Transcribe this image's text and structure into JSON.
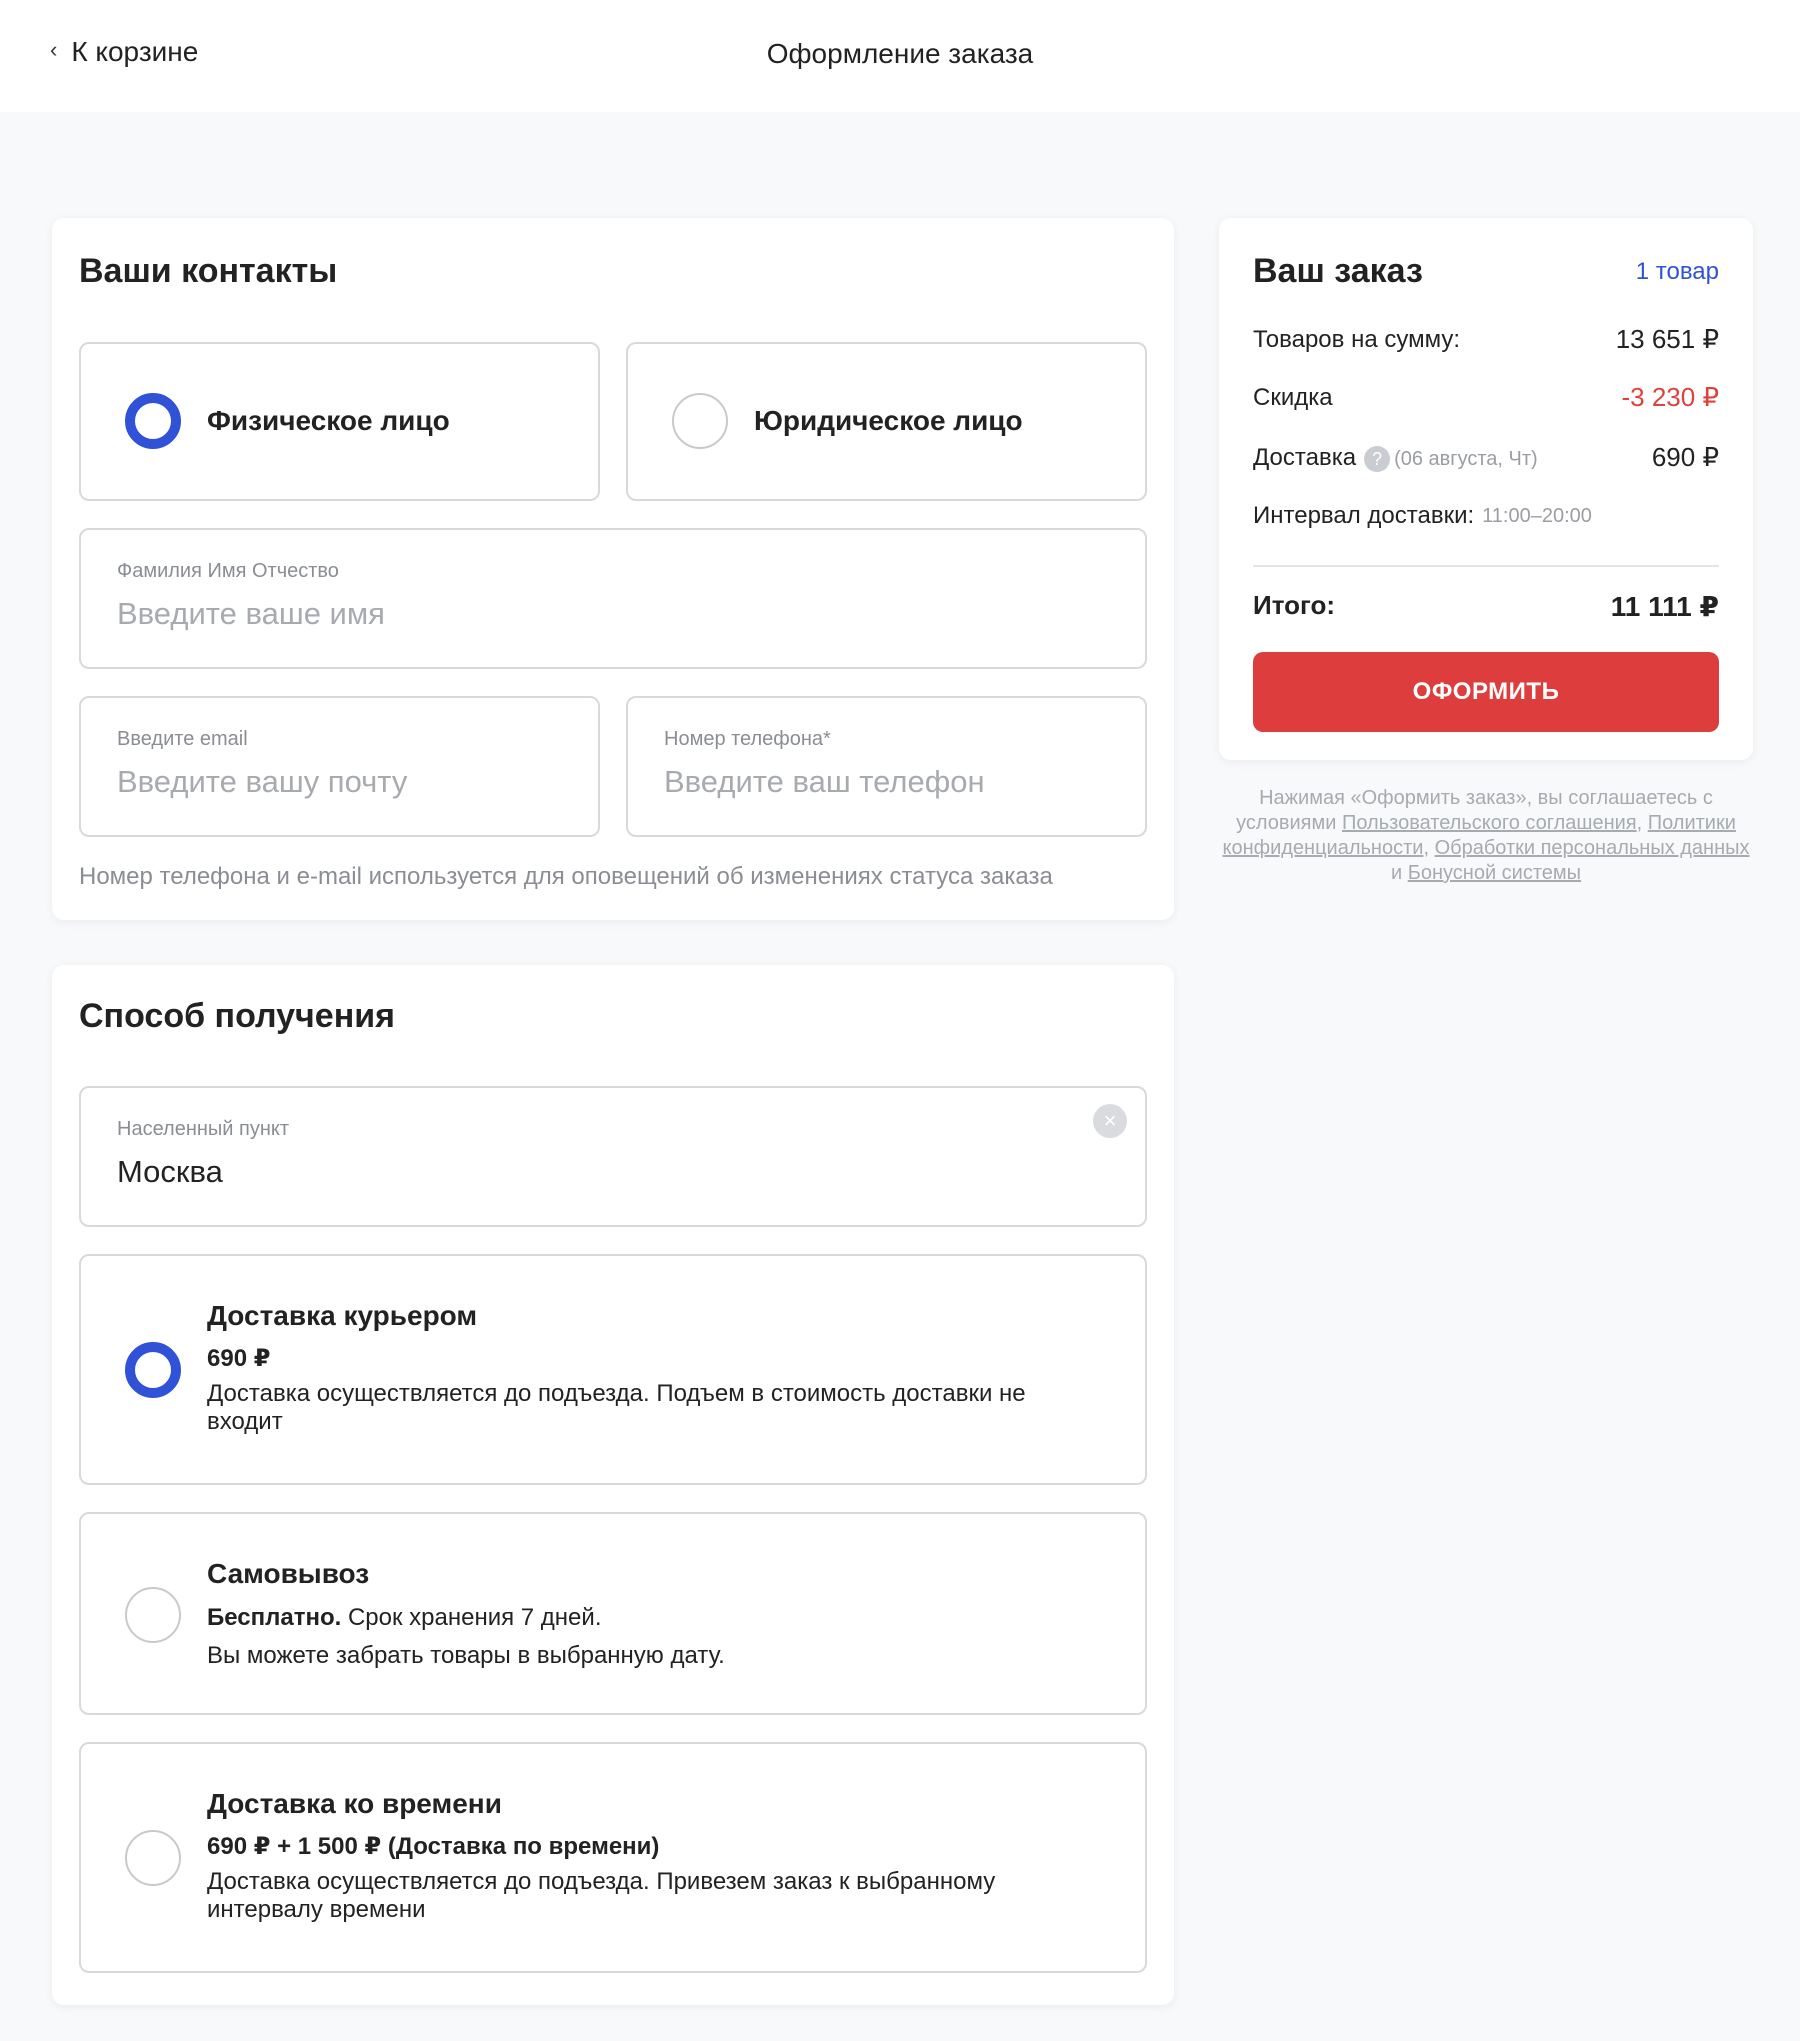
{
  "header": {
    "back_label": "К корзине",
    "title": "Оформление заказа"
  },
  "contacts": {
    "title": "Ваши контакты",
    "types": [
      {
        "label": "Физическое лицо",
        "selected": true
      },
      {
        "label": "Юридическое лицо",
        "selected": false
      }
    ],
    "name_field": {
      "label": "Фамилия Имя Отчество",
      "placeholder": "Введите ваше имя",
      "value": ""
    },
    "email_field": {
      "label": "Введите email",
      "placeholder": "Введите вашу почту",
      "value": ""
    },
    "phone_field": {
      "label": "Номер телефона*",
      "placeholder": "Введите ваш телефон",
      "value": ""
    },
    "hint": "Номер телефона и e-mail используется для оповещений об изменениях статуса заказа"
  },
  "delivery": {
    "title": "Способ получения",
    "city_field": {
      "label": "Населенный пункт",
      "value": "Москва"
    },
    "options": [
      {
        "title": "Доставка курьером",
        "price": "690 ₽",
        "description": "Доставка осуществляется до подъезда. Подъем в стоимость доставки не входит",
        "selected": true
      },
      {
        "title": "Самовывоз",
        "price_bold": "Бесплатно.",
        "price_rest": "Срок хранения 7 дней.",
        "description": "Вы можете забрать товары в выбранную дату.",
        "selected": false
      },
      {
        "title": "Доставка ко времени",
        "price": "690 ₽ + 1 500 ₽ (Доставка по времени)",
        "description": "Доставка осуществляется до подъезда. Привезем заказ к выбранному интервалу времени",
        "selected": false
      }
    ]
  },
  "order": {
    "title": "Ваш заказ",
    "count": "1 товар",
    "subtotal_label": "Товаров на сумму:",
    "subtotal_value": "13 651 ₽",
    "discount_label": "Скидка",
    "discount_value": "-3 230 ₽",
    "shipping_label": "Доставка",
    "shipping_date": "(06 августа, Чт)",
    "shipping_value": "690 ₽",
    "interval_label": "Интервал доставки:",
    "interval_value": "11:00–20:00",
    "total_label": "Итого:",
    "total_value": "11 111 ₽",
    "submit_label": "ОФОРМИТЬ"
  },
  "terms": {
    "prefix": "Нажимая «Оформить заказ», вы соглашаетесь с условиями",
    "link1": "Пользовательского соглашения",
    "sep1": ",",
    "link2": "Политики конфиденциальности",
    "sep2": ",",
    "link3": "Обработки персональных данных",
    "and": "и",
    "link4": "Бонусной системы"
  },
  "colors": {
    "accent_blue": "#2f52d6",
    "submit_red": "#dd3e3d",
    "discount_red": "#e0413a"
  },
  "icons": {
    "back": "chevron-left-icon",
    "help": "question-circle-icon",
    "clear": "close-circle-icon"
  }
}
